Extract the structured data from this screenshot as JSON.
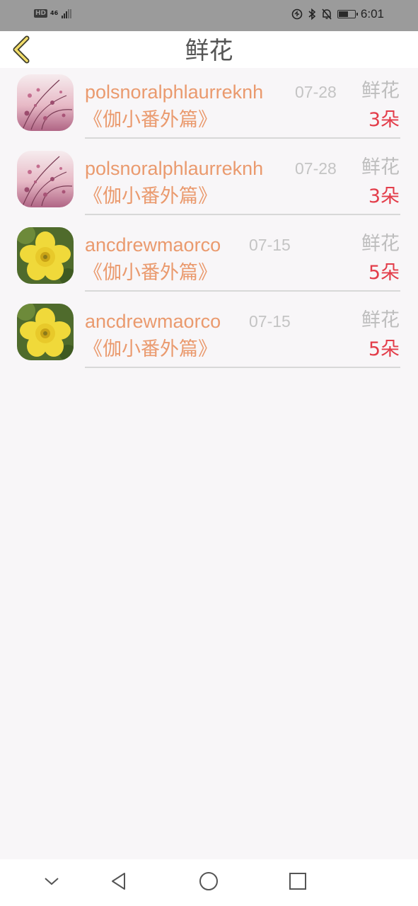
{
  "status_bar": {
    "hd": "HD",
    "network": "46",
    "time": "6:01",
    "battery_level": 0.6
  },
  "header": {
    "title": "鲜花",
    "back_icon": "chevron-left-icon"
  },
  "records": [
    {
      "username": "polsnoralphlaurreknh",
      "date": "07-28",
      "gift_type": "鲜花",
      "book": "《伽小番外篇》",
      "count": "3朵",
      "avatar": "pink-blossom-photo"
    },
    {
      "username": "polsnoralphlaurreknh",
      "date": "07-28",
      "gift_type": "鲜花",
      "book": "《伽小番外篇》",
      "count": "3朵",
      "avatar": "pink-blossom-photo"
    },
    {
      "username": "ancdrewmaorco",
      "date": "07-15",
      "gift_type": "鲜花",
      "book": "《伽小番外篇》",
      "count": "5朵",
      "avatar": "yellow-flower-photo"
    },
    {
      "username": "ancdrewmaorco",
      "date": "07-15",
      "gift_type": "鲜花",
      "book": "《伽小番外篇》",
      "count": "5朵",
      "avatar": "yellow-flower-photo"
    }
  ],
  "colors": {
    "accent_orange": "#ea9a6e",
    "count_red": "#e33d4a",
    "muted_gray": "#c4c4c4",
    "back_icon_yellow": "#f3dd6b"
  },
  "system_nav": {
    "icons": [
      "chevron-down-icon",
      "back-triangle-icon",
      "home-circle-icon",
      "recents-square-icon"
    ]
  }
}
